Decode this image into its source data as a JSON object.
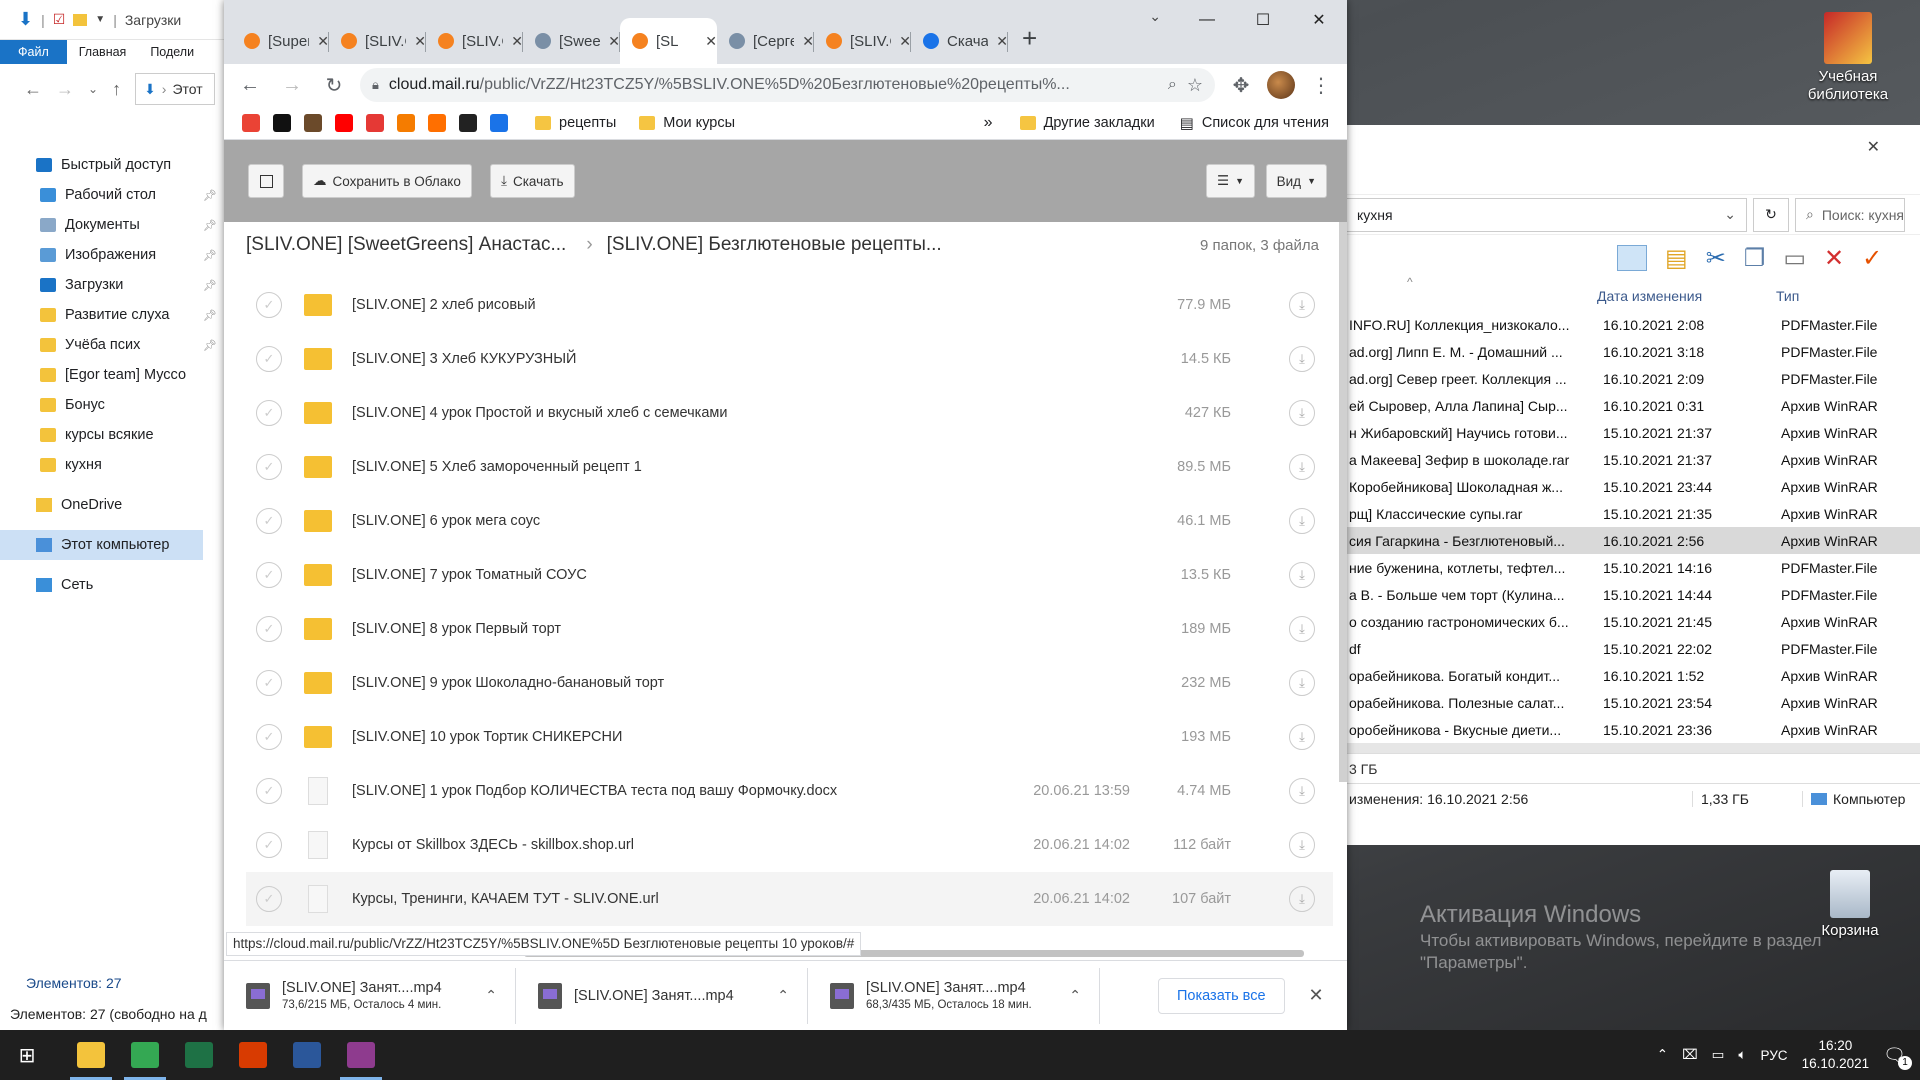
{
  "desktop": {
    "icons": [
      {
        "label": "Учебная библиотека"
      },
      {
        "label": "Корзина"
      }
    ],
    "watermark_title": "Активация Windows",
    "watermark_sub": "Чтобы активировать Windows, перейдите в раздел",
    "watermark_sub2": "\"Параметры\"."
  },
  "explorer_left": {
    "title": "Загрузки",
    "ribbon_tabs": [
      "Файл",
      "Главная",
      "Подели"
    ],
    "address": "Этот",
    "tree": [
      {
        "label": "Быстрый доступ",
        "pin": false,
        "kind": "star"
      },
      {
        "label": "Рабочий стол",
        "pin": true,
        "kind": "desk"
      },
      {
        "label": "Документы",
        "pin": true,
        "kind": "doc"
      },
      {
        "label": "Изображения",
        "pin": true,
        "kind": "img"
      },
      {
        "label": "Загрузки",
        "pin": true,
        "kind": "dl"
      },
      {
        "label": "Развитие слуха",
        "pin": true,
        "kind": "folder"
      },
      {
        "label": "Учёба псих",
        "pin": true,
        "kind": "folder"
      },
      {
        "label": "[Egor team] Муссо",
        "pin": false,
        "kind": "folder"
      },
      {
        "label": "Бонус",
        "pin": false,
        "kind": "folder"
      },
      {
        "label": "курсы всякие",
        "pin": false,
        "kind": "folder"
      },
      {
        "label": "кухня",
        "pin": false,
        "kind": "folder"
      }
    ],
    "onedrive": "OneDrive",
    "this_pc": "Этот компьютер",
    "network": "Сеть",
    "items_count": "Элементов: 27",
    "status_bar": "Элементов: 27 (свободно на д"
  },
  "explorer_right": {
    "address": "кухня",
    "search_placeholder": "Поиск: кухня",
    "col_date": "Дата изменения",
    "col_type": "Тип",
    "rows": [
      {
        "name": "INFO.RU] Коллекция_низкокало...",
        "date": "16.10.2021 2:08",
        "type": "PDFMaster.File"
      },
      {
        "name": "ad.org] Липп Е. М. - Домашний ...",
        "date": "16.10.2021 3:18",
        "type": "PDFMaster.File"
      },
      {
        "name": "ad.org] Север греет. Коллекция ...",
        "date": "16.10.2021 2:09",
        "type": "PDFMaster.File"
      },
      {
        "name": "ей Сыровер, Алла Лапина] Сыр...",
        "date": "16.10.2021 0:31",
        "type": "Архив WinRAR"
      },
      {
        "name": "н Жибаровский] Научись готови...",
        "date": "15.10.2021 21:37",
        "type": "Архив WinRAR"
      },
      {
        "name": "а Макеева] Зефир в шоколаде.rar",
        "date": "15.10.2021 21:37",
        "type": "Архив WinRAR"
      },
      {
        "name": "Коробейникова] Шоколадная ж...",
        "date": "15.10.2021 23:44",
        "type": "Архив WinRAR"
      },
      {
        "name": "рщ] Классические супы.rar",
        "date": "15.10.2021 21:35",
        "type": "Архив WinRAR"
      },
      {
        "name": "сия Гагаркина - Безглютеновый...",
        "date": "16.10.2021 2:56",
        "type": "Архив WinRAR",
        "selected": true
      },
      {
        "name": "ние буженина, котлеты, тефтел...",
        "date": "15.10.2021 14:16",
        "type": "PDFMaster.File"
      },
      {
        "name": "а В. - Больше чем торт (Кулина...",
        "date": "15.10.2021 14:44",
        "type": "PDFMaster.File"
      },
      {
        "name": "о созданию гастрономических б...",
        "date": "15.10.2021 21:45",
        "type": "Архив WinRAR"
      },
      {
        "name": "df",
        "date": "15.10.2021 22:02",
        "type": "PDFMaster.File"
      },
      {
        "name": "орабейникова. Богатый кондит...",
        "date": "16.10.2021 1:52",
        "type": "Архив WinRAR"
      },
      {
        "name": "орабейникова. Полезные салат...",
        "date": "15.10.2021 23:54",
        "type": "Архив WinRAR"
      },
      {
        "name": "оробейникова - Вкусные диети...",
        "date": "15.10.2021 23:36",
        "type": "Архив WinRAR"
      }
    ],
    "size_line": "3 ГБ",
    "footer_modified": "изменения: 16.10.2021 2:56",
    "footer_size": "1,33 ГБ",
    "footer_location": "Компьютер"
  },
  "chrome": {
    "tabs": [
      {
        "title": "[Super",
        "color": "#f58220"
      },
      {
        "title": "[SLIV.O",
        "color": "#f58220"
      },
      {
        "title": "[SLIV.O",
        "color": "#f58220"
      },
      {
        "title": "[Sweet",
        "color": "#7a8fa6"
      },
      {
        "title": "[SL",
        "color": "#f58220",
        "active": true
      },
      {
        "title": "[Серге",
        "color": "#7a8fa6"
      },
      {
        "title": "[SLIV.O",
        "color": "#f58220"
      },
      {
        "title": "Скача",
        "color": "#1a73e8"
      }
    ],
    "url_host": "cloud.mail.ru",
    "url_path": "/public/VrZZ/Ht23TCZ5Y/%5BSLIV.ONE%5D%20Безглютеновые%20рецепты%...",
    "bookmarks": [
      {
        "label": "рецепты"
      },
      {
        "label": "Мои курсы"
      }
    ],
    "bookmark_icons": [
      {
        "color": "#ea4335"
      },
      {
        "color": "#111111"
      },
      {
        "color": "#6b4a2a"
      },
      {
        "color": "#ff0000"
      },
      {
        "color": "#e53935"
      },
      {
        "color": "#f57c00"
      },
      {
        "color": "#ff6f00"
      },
      {
        "color": "#222222"
      },
      {
        "color": "#1a73e8"
      }
    ],
    "other_bookmarks": "Другие закладки",
    "reading_list": "Список для чтения",
    "status_url": "https://cloud.mail.ru/public/VrZZ/Ht23TCZ5Y/%5BSLIV.ONE%5D Безглютеновые рецепты 10 уроков/#"
  },
  "cloud": {
    "save_btn": "Сохранить в Облако",
    "download_btn": "Скачать",
    "view_btn": "Вид",
    "breadcrumb_parent": "[SLIV.ONE] [SweetGreens] Анастас...",
    "breadcrumb_current": "[SLIV.ONE] Безглютеновые рецепты...",
    "counts": "9 папок, 3 файла",
    "rows": [
      {
        "name": "[SLIV.ONE] 2 хлеб рисовый",
        "date": "",
        "size": "77.9 МБ",
        "kind": "folder"
      },
      {
        "name": "[SLIV.ONE] 3 Хлеб КУКУРУЗНЫЙ",
        "date": "",
        "size": "14.5 КБ",
        "kind": "folder"
      },
      {
        "name": "[SLIV.ONE] 4 урок Простой и вкусный хлеб с семечками",
        "date": "",
        "size": "427 КБ",
        "kind": "folder"
      },
      {
        "name": "[SLIV.ONE] 5 Хлеб замороченный рецепт 1",
        "date": "",
        "size": "89.5 МБ",
        "kind": "folder"
      },
      {
        "name": "[SLIV.ONE] 6 урок мега соус",
        "date": "",
        "size": "46.1 МБ",
        "kind": "folder"
      },
      {
        "name": "[SLIV.ONE] 7 урок Томатный СОУС",
        "date": "",
        "size": "13.5 КБ",
        "kind": "folder"
      },
      {
        "name": "[SLIV.ONE] 8 урок Первый торт",
        "date": "",
        "size": "189 МБ",
        "kind": "folder"
      },
      {
        "name": "[SLIV.ONE] 9 урок Шоколадно-банановый торт",
        "date": "",
        "size": "232 МБ",
        "kind": "folder"
      },
      {
        "name": "[SLIV.ONE] 10 урок Тортик СНИКЕРСНИ",
        "date": "",
        "size": "193 МБ",
        "kind": "folder"
      },
      {
        "name": "[SLIV.ONE] 1 урок Подбор КОЛИЧЕСТВА теста под вашу Формочку.docx",
        "date": "20.06.21 13:59",
        "size": "4.74 МБ",
        "kind": "doc"
      },
      {
        "name": "Курсы от Skillbox ЗДЕСЬ - skillbox.shop.url",
        "date": "20.06.21 14:02",
        "size": "112 байт",
        "kind": "doc"
      },
      {
        "name": "Курсы, Тренинги, КАЧАЕМ ТУТ - SLIV.ONE.url",
        "date": "20.06.21 14:02",
        "size": "107 байт",
        "kind": "doc",
        "hover": true
      }
    ]
  },
  "downloads": {
    "items": [
      {
        "name": "[SLIV.ONE] Занят....mp4",
        "progress": "73,6/215 МБ, Осталось 4 мин."
      },
      {
        "name": "[SLIV.ONE] Занят....mp4",
        "progress": ""
      },
      {
        "name": "[SLIV.ONE] Занят....mp4",
        "progress": "68,3/435 МБ, Осталось 18 мин."
      }
    ],
    "show_all": "Показать все"
  },
  "taskbar": {
    "apps": [
      {
        "name": "explorer",
        "color": "#f3c33c",
        "active": true
      },
      {
        "name": "chrome",
        "color": "#34a853",
        "active": true
      },
      {
        "name": "excel",
        "color": "#1e7145",
        "active": false
      },
      {
        "name": "foxit",
        "color": "#d83b01",
        "active": false
      },
      {
        "name": "word",
        "color": "#2b579a",
        "active": false
      },
      {
        "name": "winrar",
        "color": "#8e3b8e",
        "active": true
      }
    ],
    "lang": "РУС",
    "time": "16:20",
    "date": "16.10.2021",
    "notif_count": "1"
  }
}
